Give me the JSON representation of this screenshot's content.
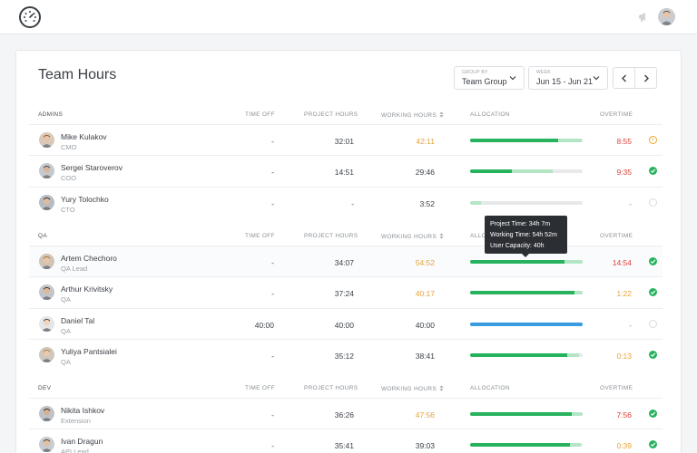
{
  "app": {
    "title": "Team Hours"
  },
  "controls": {
    "group_by": {
      "caption": "GROUP BY",
      "value": "Team Group"
    },
    "week": {
      "caption": "WEEK",
      "value": "Jun 15 - Jun 21"
    }
  },
  "columns": {
    "time_off": "TIME OFF",
    "project_hours": "PROJECT HOURS",
    "working_hours": "WORKING HOURS",
    "allocation": "ALLOCATION",
    "overtime": "OVERTIME"
  },
  "colors": {
    "green": "#27b35d",
    "light_green": "#b4e6c6",
    "blue": "#3a9be0",
    "orange": "#e8a23a",
    "red": "#e0413b"
  },
  "tooltip": {
    "project_time": "Project Time: 34h 7m",
    "working_time": "Working Time: 54h 52m",
    "user_capacity": "User Capacity: 40h"
  },
  "sections": [
    {
      "name": "ADMINS",
      "rows": [
        {
          "name": "Mike Kulakov",
          "role": "CMO",
          "time_off": "-",
          "project": "32:01",
          "working": "42:11",
          "overtime": "8:55",
          "status": "warning",
          "alloc_project_pct": 78,
          "alloc_working_pct": 99
        },
        {
          "name": "Sergei Staroverov",
          "role": "COO",
          "time_off": "-",
          "project": "14:51",
          "working": "29:46",
          "overtime": "9:35",
          "status": "ok",
          "alloc_project_pct": 37,
          "alloc_working_pct": 73
        },
        {
          "name": "Yury Tolochko",
          "role": "CTO",
          "time_off": "-",
          "project": "-",
          "working": "3:52",
          "overtime": "-",
          "status": "none",
          "alloc_project_pct": 0,
          "alloc_working_pct": 10
        }
      ]
    },
    {
      "name": "QA",
      "rows": [
        {
          "name": "Artem Chechoro",
          "role": "QA Lead",
          "time_off": "-",
          "project": "34:07",
          "working": "54:52",
          "overtime": "14:54",
          "status": "ok",
          "alloc_project_pct": 84,
          "alloc_working_pct": 100
        },
        {
          "name": "Arthur Krivitsky",
          "role": "QA",
          "time_off": "-",
          "project": "37:24",
          "working": "40:17",
          "overtime": "1:22",
          "status": "ok",
          "alloc_project_pct": 93,
          "alloc_working_pct": 100
        },
        {
          "name": "Daniel Tal",
          "role": "QA",
          "time_off": "40:00",
          "project": "40:00",
          "working": "40:00",
          "overtime": "-",
          "status": "none",
          "alloc_project_pct": 100,
          "alloc_working_pct": 100,
          "alloc_style": "time_off"
        },
        {
          "name": "Yuliya Pantsialei",
          "role": "QA",
          "time_off": "-",
          "project": "35:12",
          "working": "38:41",
          "overtime": "0:13",
          "status": "ok",
          "alloc_project_pct": 86,
          "alloc_working_pct": 97
        }
      ]
    },
    {
      "name": "DEV",
      "rows": [
        {
          "name": "Nikita Ishkov",
          "role": "Extension",
          "time_off": "-",
          "project": "36:26",
          "working": "47:56",
          "overtime": "7:56",
          "status": "ok",
          "alloc_project_pct": 90,
          "alloc_working_pct": 100
        },
        {
          "name": "Ivan Dragun",
          "role": "API Lead",
          "time_off": "-",
          "project": "35:41",
          "working": "39:03",
          "overtime": "0:39",
          "status": "ok",
          "alloc_project_pct": 89,
          "alloc_working_pct": 98
        }
      ]
    }
  ]
}
